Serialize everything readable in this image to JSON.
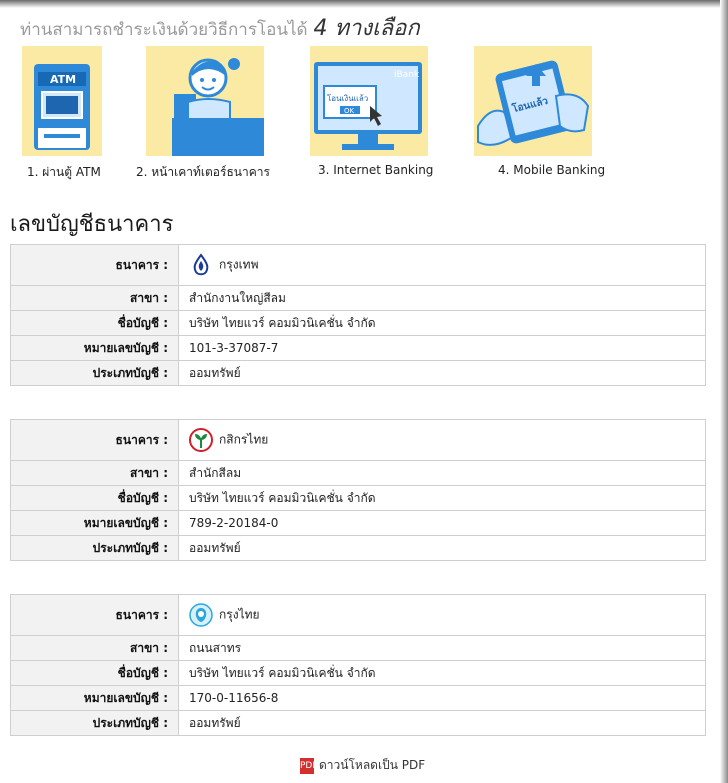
{
  "headline": {
    "text": "ท่านสามารถชำระเงินด้วยวิธีการโอนได้",
    "emphasis": "4 ทางเลือก"
  },
  "methods": [
    {
      "label": "1. ผ่านตู้ ATM",
      "icon": "atm-icon",
      "art_text": "ATM"
    },
    {
      "label": "2. หน้าเคาท์เตอร์ธนาคาร",
      "icon": "bank-counter-icon"
    },
    {
      "label": "3. Internet Banking",
      "icon": "internet-banking-icon",
      "art_text": "iBank",
      "art_text2": "โอนเงินแล้ว",
      "art_ok": "OK"
    },
    {
      "label": "4. Mobile Banking",
      "icon": "mobile-banking-icon",
      "art_text": "โอนแล้ว"
    }
  ],
  "section_title": "เลขบัญชีธนาคาร",
  "labels": {
    "bank": "ธนาคาร :",
    "branch": "สาขา :",
    "account_name": "ชื่อบัญชี :",
    "account_no": "หมายเลขบัญชี :",
    "account_type": "ประเภทบัญชี :"
  },
  "banks": [
    {
      "name": "กรุงเทพ",
      "branch": "สำนักงานใหญ่สีลม",
      "account_name": "บริษัท ไทยแวร์ คอมมิวนิเคชั่น จำกัด",
      "account_no": "101-3-37087-7",
      "account_type": "ออมทรัพย์",
      "logo": "bangkok-bank-logo",
      "color": "#1e3c96"
    },
    {
      "name": "กสิกรไทย",
      "branch": "สำนักสีลม",
      "account_name": "บริษัท ไทยแวร์ คอมมิวนิเคชั่น จำกัด",
      "account_no": "789-2-20184-0",
      "account_type": "ออมทรัพย์",
      "logo": "kasikorn-bank-logo",
      "color": "#1b8a3c"
    },
    {
      "name": "กรุงไทย",
      "branch": "ถนนสาทร",
      "account_name": "บริษัท ไทยแวร์ คอมมิวนิเคชั่น จำกัด",
      "account_no": "170-0-11656-8",
      "account_type": "ออมทรัพย์",
      "logo": "krungthai-bank-logo",
      "color": "#2aa7df"
    }
  ],
  "download": {
    "label": "ดาวน์โหลดเป็น PDF",
    "icon": "pdf-icon",
    "icon_text": "PDF"
  }
}
